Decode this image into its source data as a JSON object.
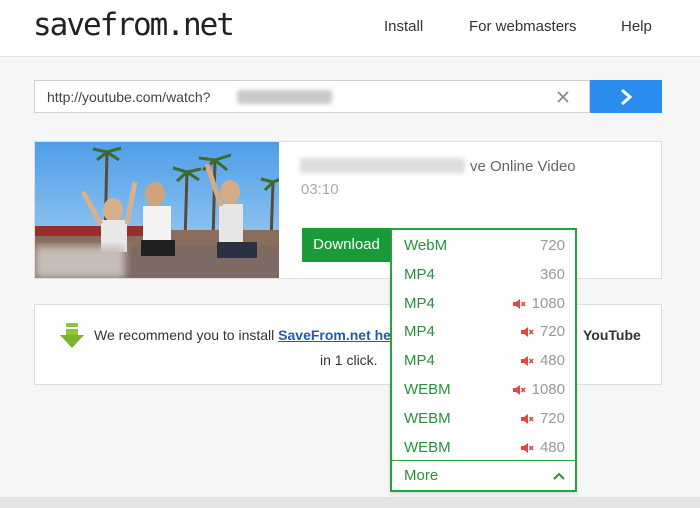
{
  "header": {
    "logo": "savefrom.net",
    "nav": [
      "Install",
      "For webmasters",
      "Help"
    ]
  },
  "search": {
    "url_value": "http://youtube.com/watch?"
  },
  "video": {
    "title_suffix": "ve Online Video",
    "duration": "03:10"
  },
  "download": {
    "button_label": "Download",
    "options": [
      {
        "format": "WebM",
        "resolution": "720",
        "audio": true
      },
      {
        "format": "MP4",
        "resolution": "360",
        "audio": true
      },
      {
        "format": "MP4",
        "resolution": "1080",
        "audio": false
      },
      {
        "format": "MP4",
        "resolution": "720",
        "audio": false
      },
      {
        "format": "MP4",
        "resolution": "480",
        "audio": false
      },
      {
        "format": "WEBM",
        "resolution": "1080",
        "audio": false
      },
      {
        "format": "WEBM",
        "resolution": "720",
        "audio": false
      },
      {
        "format": "WEBM",
        "resolution": "480",
        "audio": false
      }
    ],
    "more_label": "More"
  },
  "recommend": {
    "text": "We recommend you to install ",
    "link": "SaveFrom.net help",
    "tail": "YouTube",
    "line2": "in 1 click."
  },
  "colors": {
    "accent_green": "#26a33b",
    "go_blue": "#2a8cef",
    "mute_red": "#e04848"
  }
}
